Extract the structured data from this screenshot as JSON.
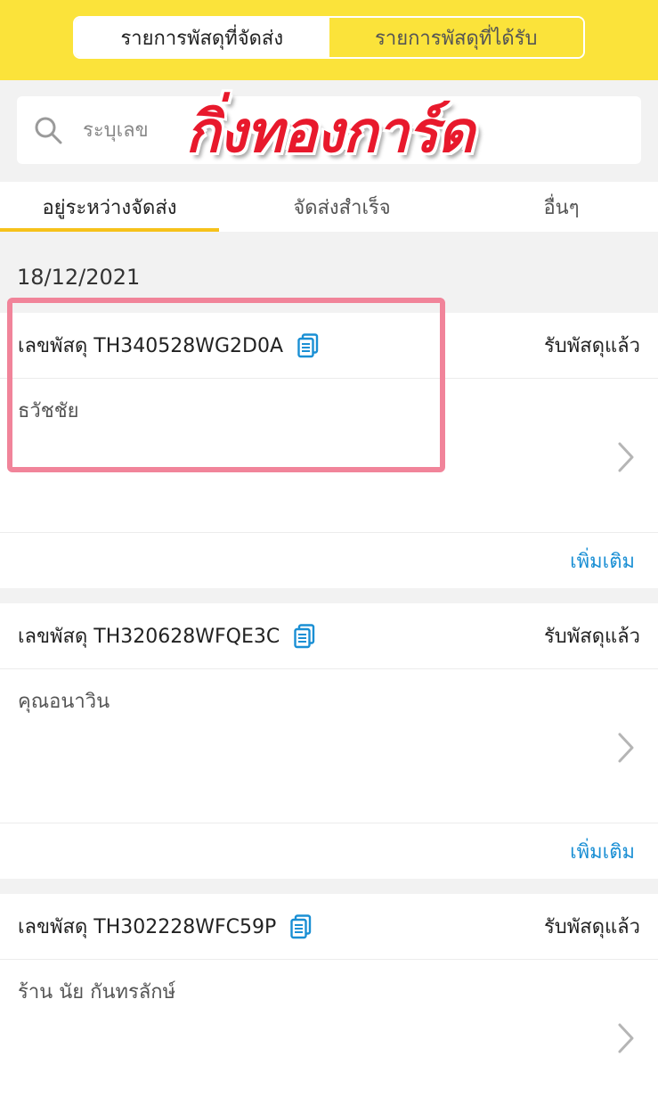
{
  "header": {
    "tabs": [
      {
        "label": "รายการพัสดุที่จัดส่ง",
        "active": true
      },
      {
        "label": "รายการพัสดุที่ได้รับ",
        "active": false
      }
    ],
    "accent_color": "#fbe33a"
  },
  "search": {
    "placeholder": "ระบุเลข"
  },
  "watermark": {
    "text": "กิ่งทองการ์ด"
  },
  "status_tabs": [
    {
      "label": "อยู่ระหว่างจัดส่ง",
      "active": true
    },
    {
      "label": "จัดส่งสำเร็จ",
      "active": false
    },
    {
      "label": "อื่นๆ",
      "active": false
    }
  ],
  "date": "18/12/2021",
  "parcels": [
    {
      "tracking": "เลขพัสดุ TH340528WG2D0A",
      "status": "รับพัสดุแล้ว",
      "recipient": "ธวัชชัย",
      "more": "เพิ่มเติม"
    },
    {
      "tracking": "เลขพัสดุ TH320628WFQE3C",
      "status": "รับพัสดุแล้ว",
      "recipient": "คุณอนาวิน",
      "more": "เพิ่มเติม"
    },
    {
      "tracking": "เลขพัสดุ TH302228WFC59P",
      "status": "รับพัสดุแล้ว",
      "recipient": "ร้าน นัย กันทรลักษ์",
      "more": ""
    }
  ],
  "colors": {
    "link": "#1a8fd4",
    "highlight": "#f1849a",
    "tab_indicator": "#f6c21a"
  }
}
